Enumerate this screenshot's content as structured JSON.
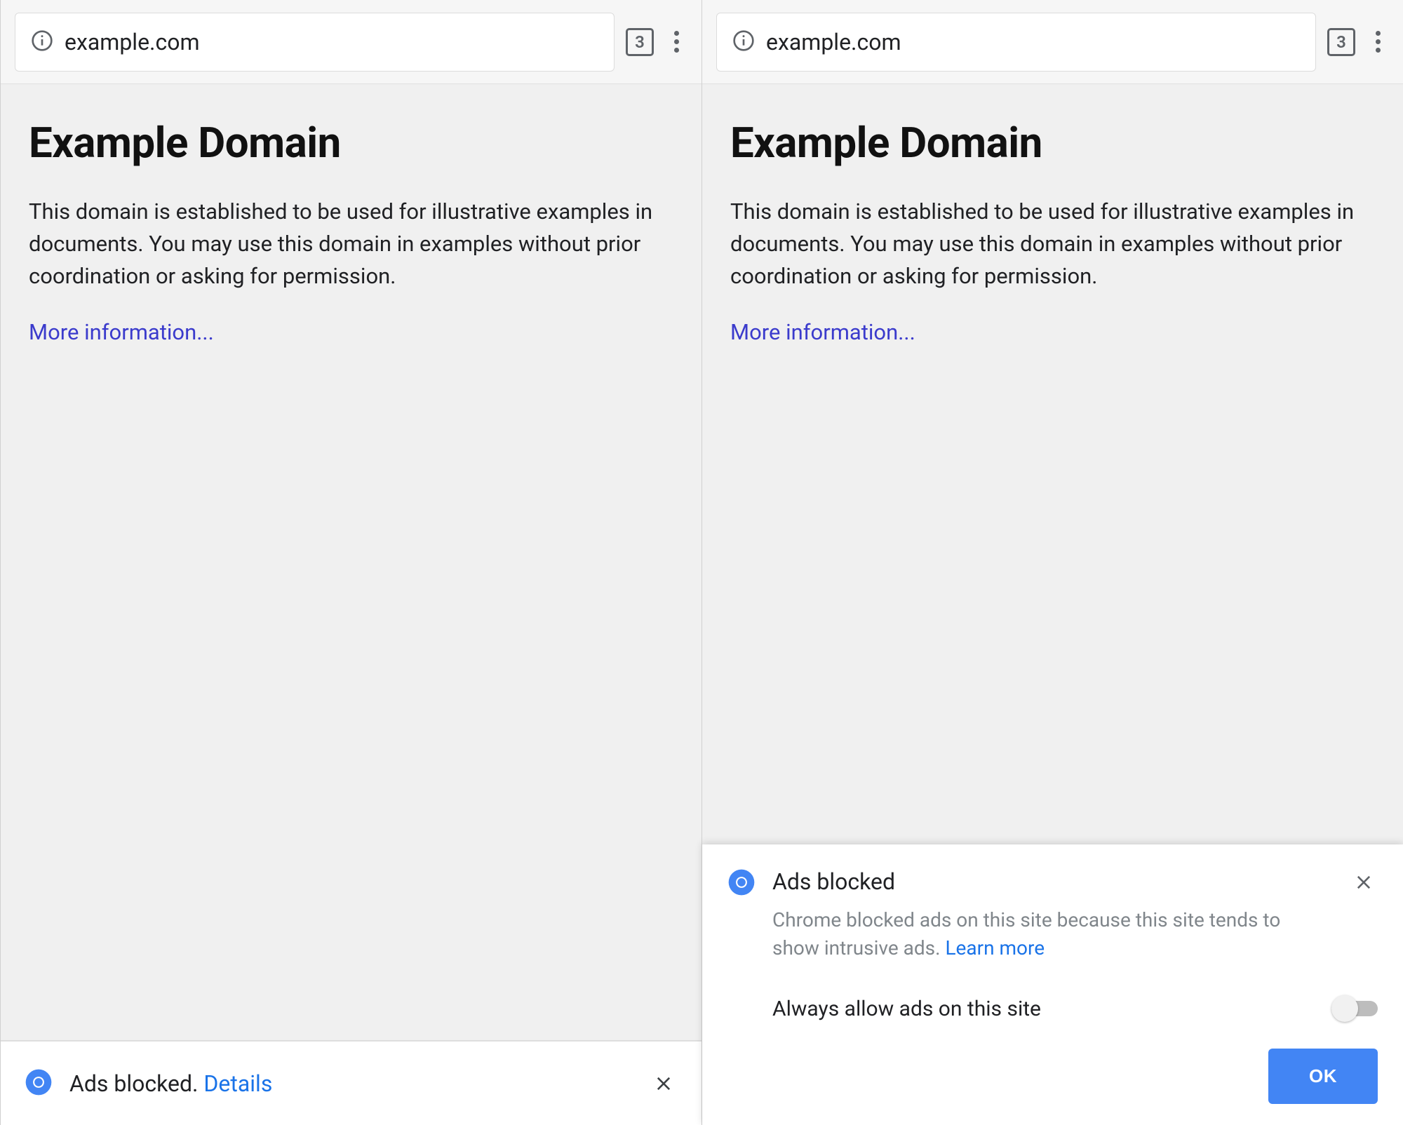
{
  "toolbar": {
    "url": "example.com",
    "tab_count": "3"
  },
  "page": {
    "title": "Example Domain",
    "body": "This domain is established to be used for illustrative examples in documents. You may use this domain in examples without prior coordination or asking for permission.",
    "link": "More information..."
  },
  "snackbar": {
    "text": "Ads blocked.",
    "details_label": "Details"
  },
  "ads_card": {
    "title": "Ads blocked",
    "body": "Chrome blocked ads on this site because this site tends to show intrusive ads.",
    "learn_more": "Learn more",
    "allow_label": "Always allow ads on this site",
    "ok_label": "OK"
  },
  "colors": {
    "accent": "#4285f4",
    "link": "#1a73e8",
    "muted": "#5f6368"
  }
}
